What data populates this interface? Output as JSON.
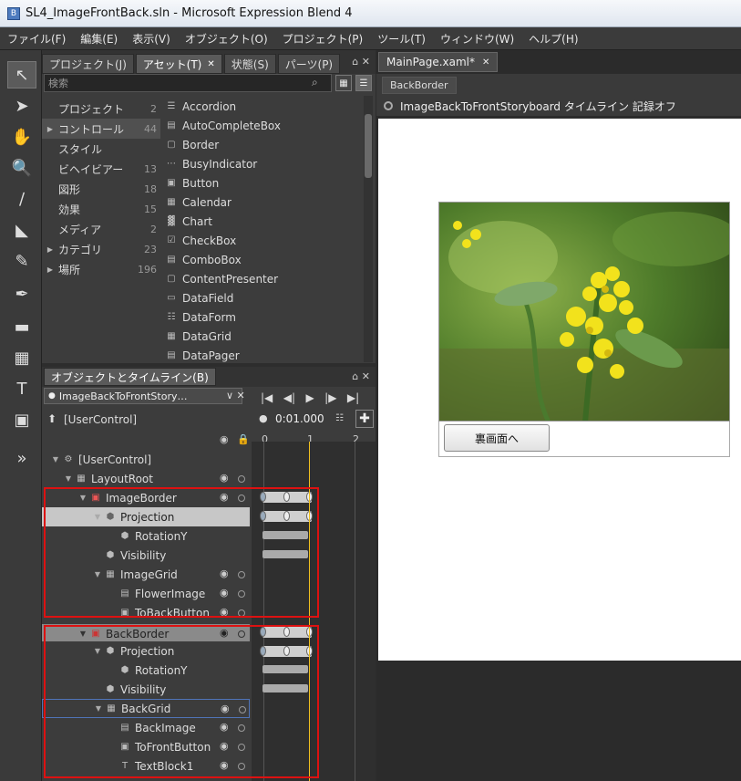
{
  "window": {
    "title": "SL4_ImageFrontBack.sln - Microsoft Expression Blend 4"
  },
  "menu": [
    "ファイル(F)",
    "編集(E)",
    "表示(V)",
    "オブジェクト(O)",
    "プロジェクト(P)",
    "ツール(T)",
    "ウィンドウ(W)",
    "ヘルプ(H)"
  ],
  "panel_tabs": [
    "プロジェクト(J)",
    "アセット(T)",
    "状態(S)",
    "パーツ(P)"
  ],
  "search": {
    "placeholder": "検索"
  },
  "categories": [
    {
      "label": "プロジェクト",
      "count": "2"
    },
    {
      "label": "コントロール",
      "count": "44"
    },
    {
      "label": "スタイル",
      "count": ""
    },
    {
      "label": "ビヘイビアー",
      "count": "13"
    },
    {
      "label": "図形",
      "count": "18"
    },
    {
      "label": "効果",
      "count": "15"
    },
    {
      "label": "メディア",
      "count": "2"
    },
    {
      "label": "カテゴリ",
      "count": "23"
    },
    {
      "label": "場所",
      "count": "196"
    }
  ],
  "assets": [
    "Accordion",
    "AutoCompleteBox",
    "Border",
    "BusyIndicator",
    "Button",
    "Calendar",
    "Chart",
    "CheckBox",
    "ComboBox",
    "ContentPresenter",
    "DataField",
    "DataForm",
    "DataGrid",
    "DataPager"
  ],
  "objects_panel": {
    "title": "オブジェクトとタイムライン(B)",
    "storyboard": "ImageBackToFrontStory…",
    "root": "[UserControl]",
    "time": "0:01.000",
    "ruler": [
      "0",
      "1",
      "2"
    ]
  },
  "tree": [
    {
      "label": "[UserControl]"
    },
    {
      "label": "LayoutRoot"
    },
    {
      "label": "ImageBorder"
    },
    {
      "label": "Projection"
    },
    {
      "label": "RotationY"
    },
    {
      "label": "Visibility"
    },
    {
      "label": "ImageGrid"
    },
    {
      "label": "FlowerImage"
    },
    {
      "label": "ToBackButton"
    },
    {
      "label": "BackBorder"
    },
    {
      "label": "Projection"
    },
    {
      "label": "RotationY"
    },
    {
      "label": "Visibility"
    },
    {
      "label": "BackGrid"
    },
    {
      "label": "BackImage"
    },
    {
      "label": "ToFrontButton"
    },
    {
      "label": "TextBlock1"
    }
  ],
  "document": {
    "tab": "MainPage.xaml*",
    "breadcrumb": "BackBorder",
    "storyboard_status": "ImageBackToFrontStoryboard タイムライン 記録オフ",
    "button_label": "裏画面へ"
  }
}
